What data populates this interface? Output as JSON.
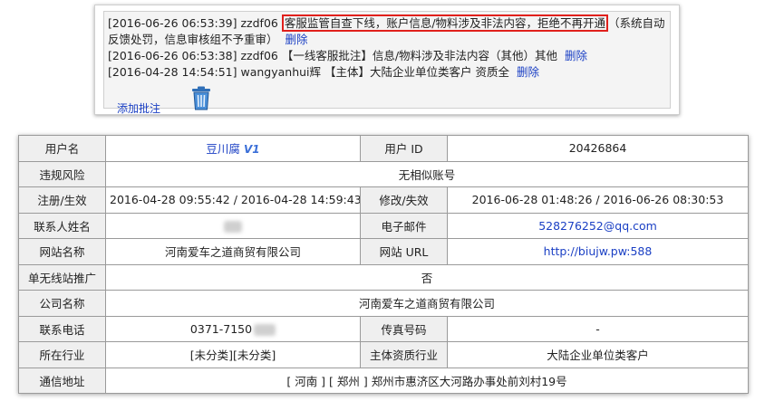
{
  "log": {
    "entries": [
      {
        "prefix": "[2016-06-26 06:53:39] zzdf06 ",
        "highlighted": "客服监管自查下线，账户信息/物料涉及非法内容，拒绝不再开通",
        "rest": "（系统自动反馈处罚，信息审核组不予重审）",
        "delete": "删除"
      },
      {
        "text": "[2016-06-26 06:53:38] zzdf06 【一线客服批注】信息/物料涉及非法内容（其他）其他",
        "delete": "删除"
      },
      {
        "text": "[2016-04-28 14:54:51] wangyanhui辉 【主体】大陆企业单位类客户 资质全",
        "delete": "删除"
      }
    ],
    "add_note": "添加批注",
    "trash_icon": "trash-icon"
  },
  "table": {
    "username_label": "用户名",
    "username_value": "豆川腐",
    "vip_badge": "V1",
    "user_id_label": "用户 ID",
    "user_id_value": "20426864",
    "risk_label": "违规风险",
    "risk_value": "无相似账号",
    "reg_label": "注册/生效",
    "reg_value": "2016-04-28 09:55:42 / 2016-04-28 14:59:43",
    "mod_label": "修改/失效",
    "mod_value": "2016-06-28 01:48:26 / 2016-06-26 08:30:53",
    "contact_label": "联系人姓名",
    "email_label": "电子邮件",
    "email_value": "528276252@qq.com",
    "site_name_label": "网站名称",
    "site_name_value": "河南爱车之道商贸有限公司",
    "site_url_label": "网站 URL",
    "site_url_value": "http://biujw.pw:588",
    "single_label": "单无线站推广",
    "single_value": "否",
    "company_label": "公司名称",
    "company_value": "河南爱车之道商贸有限公司",
    "phone_label": "联系电话",
    "phone_value": "0371-7150",
    "fax_label": "传真号码",
    "fax_value": "-",
    "industry_label": "所在行业",
    "industry_value": "[未分类][未分类]",
    "qual_label": "主体资质行业",
    "qual_value": "大陆企业单位类客户",
    "address_label": "通信地址",
    "address_value": "[ 河南 ] [ 郑州 ] 郑州市惠济区大河路办事处前刘村19号"
  }
}
